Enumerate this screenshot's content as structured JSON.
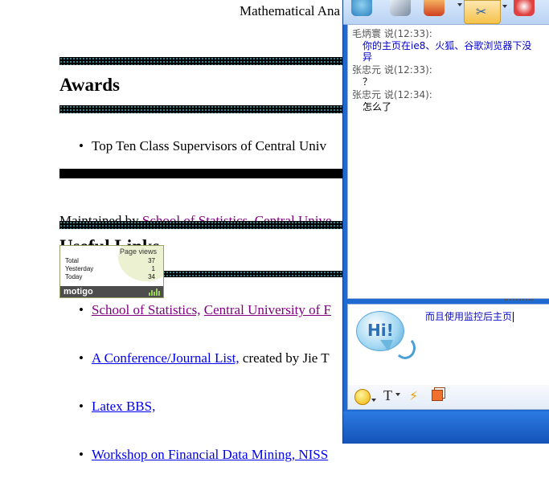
{
  "page": {
    "heading_top": "Mathematical Ana",
    "awards_heading": "Awards",
    "award_item": "Top Ten Class Supervisors of Central Univ",
    "maintained_prefix": "Maintained by ",
    "maintained_link": "School of Statistics, Central Unive",
    "useful_links_heading": "Useful Links",
    "links": [
      {
        "part1": "School of Statistics,",
        "part2": "Central University of F",
        "suffix": ""
      },
      {
        "part1": "A Conference/Journal List,",
        "part2": "",
        "suffix": " created by Jie T"
      },
      {
        "part1": "Latex BBS,",
        "part2": "",
        "suffix": ""
      },
      {
        "part1": "Workshop on Financial Data Mining, NISS",
        "part2": "",
        "suffix": ""
      }
    ]
  },
  "widget": {
    "title": "Page views",
    "rows": [
      {
        "label": "Total",
        "value": "37"
      },
      {
        "label": "Yesterday",
        "value": "1"
      },
      {
        "label": "Today",
        "value": "34"
      }
    ],
    "brand": "motigo"
  },
  "chat": {
    "toolbar_icons": [
      "globe-icon",
      "phone-icon",
      "folder-icon",
      "scissors-icon",
      "block-icon"
    ],
    "messages": [
      {
        "sender": "毛炳寰",
        "said": "说(12:33):",
        "body": "你的主页在ie8、火狐、谷歌浏览器下没",
        "body2": "异",
        "color": "#0000cc"
      },
      {
        "sender": "张忠元",
        "said": "说(12:33):",
        "body": "？",
        "color": "#000000"
      },
      {
        "sender": "张忠元",
        "said": "说(12:34):",
        "body": "怎么了",
        "color": "#000000"
      }
    ],
    "hi_text": "Hi!",
    "input_text": "而且使用监控后主页",
    "format_icons": [
      "emoticon-icon",
      "font-icon",
      "nudge-icon",
      "screenshot-icon"
    ],
    "font_label": "T"
  },
  "colors": {
    "visited": "#800080",
    "link": "#0000ee",
    "chat_blue": "#1f6ad2"
  }
}
